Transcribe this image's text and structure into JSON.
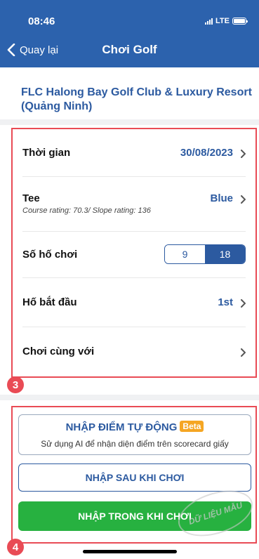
{
  "status_bar": {
    "time": "08:46",
    "network": "LTE"
  },
  "nav": {
    "back_label": "Quay lại",
    "title": "Chơi Golf"
  },
  "club_name": "FLC Halong Bay Golf Club & Luxury Resort (Quảng Ninh)",
  "settings": {
    "time": {
      "label": "Thời gian",
      "value": "30/08/2023"
    },
    "tee": {
      "label": "Tee",
      "value": "Blue",
      "sub": "Course rating: 70.3/ Slope rating: 136"
    },
    "holes": {
      "label": "Số hố chơi",
      "options": [
        "9",
        "18"
      ],
      "selected": "18"
    },
    "start_hole": {
      "label": "Hố bắt đầu",
      "value": "1st"
    },
    "play_with": {
      "label": "Chơi cùng với"
    }
  },
  "annotations": {
    "badge_settings": "3",
    "badge_buttons": "4"
  },
  "actions": {
    "auto_title": "NHẬP ĐIỂM TỰ ĐỘNG",
    "auto_badge": "Beta",
    "auto_desc": "Sử dụng AI để nhận diện điểm trên scorecard giấy",
    "after_label": "NHẬP SAU KHI CHƠI",
    "during_label": "NHẬP TRONG KHI CHƠI"
  },
  "watermark": "DỮ LIỆU MẪU",
  "colors": {
    "primary": "#2c62ad",
    "accent_green": "#27b140",
    "highlight_red": "#e94b55",
    "beta_orange": "#f5a623"
  }
}
